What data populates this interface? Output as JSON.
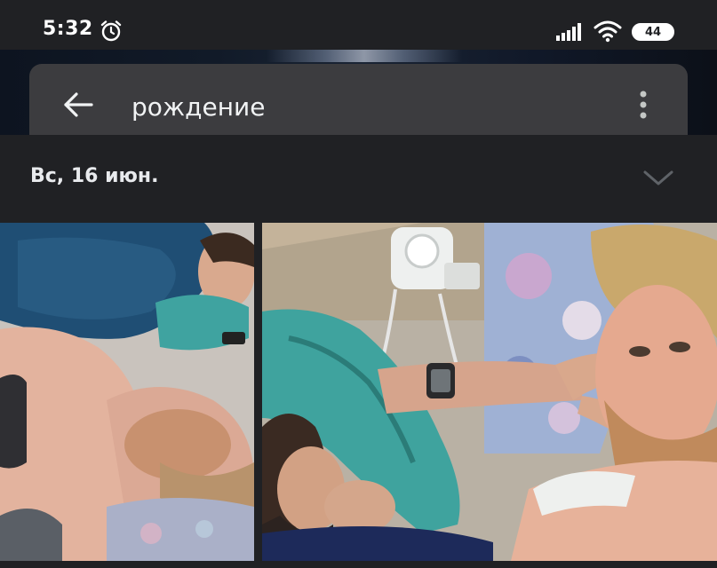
{
  "status_bar": {
    "time": "5:32",
    "battery": "44",
    "icons": [
      "alarm-icon",
      "signal-icon",
      "wifi-icon",
      "battery-icon"
    ]
  },
  "search": {
    "query": "рождение",
    "back_icon": "arrow-left-icon",
    "more_icon": "more-vert-icon"
  },
  "results": {
    "date_label": "Вс, 16 июн.",
    "expand_icon": "chevron-down-icon",
    "photos": [
      {
        "kind": "photo-thumbnail"
      },
      {
        "kind": "photo-thumbnail"
      }
    ]
  },
  "colors": {
    "background": "#202124",
    "search_bar": "#3c3c3f",
    "text": "#e8eaed"
  }
}
